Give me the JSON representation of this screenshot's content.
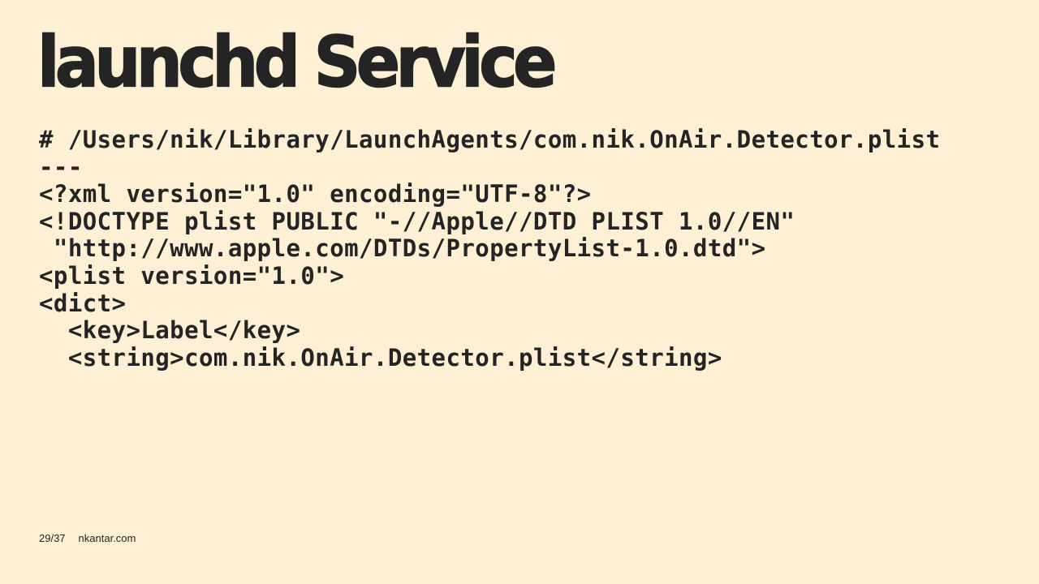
{
  "slide": {
    "title": "launchd Service",
    "code_lines": [
      "# /Users/nik/Library/LaunchAgents/com.nik.OnAir.Detector.plist",
      "---",
      "<?xml version=\"1.0\" encoding=\"UTF-8\"?>",
      "<!DOCTYPE plist PUBLIC \"-//Apple//DTD PLIST 1.0//EN\"",
      " \"http://www.apple.com/DTDs/PropertyList-1.0.dtd\">",
      "<plist version=\"1.0\">",
      "<dict>",
      "  <key>Label</key>",
      "  <string>com.nik.OnAir.Detector.plist</string>"
    ]
  },
  "footer": {
    "page_number": "29/37",
    "site": "nkantar.com"
  },
  "colors": {
    "background": "#FDF0D5",
    "text": "#242424"
  }
}
